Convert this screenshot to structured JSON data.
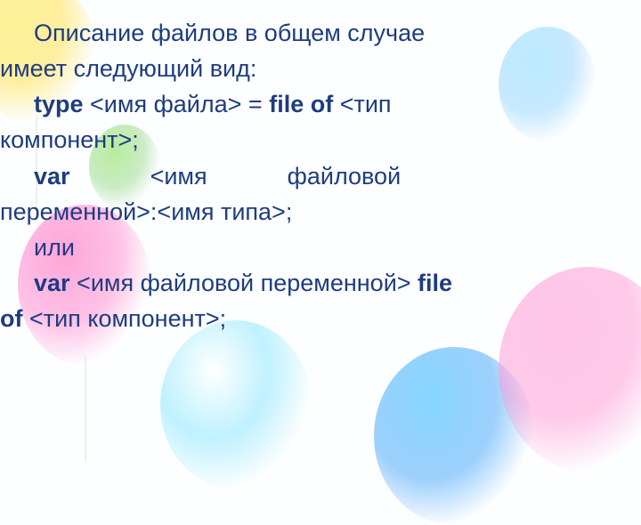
{
  "doc": {
    "intro_a": "Описание файлов в общем случае",
    "intro_b": "имеет следующий вид:",
    "kw_type": "type",
    "tok_fname_open": " <имя файла> ",
    "eq": "= ",
    "kw_fileof1": "file of",
    "tok_tipcomp_a": " <тип",
    "tok_tipcomp_b": "компонент>;",
    "kw_var1": "var",
    "var1_gap": "            ",
    "tok_fvar_open": "<имя            файловой",
    "tok_fvar_rest": "переменной>:<имя типа>;",
    "ili": "или",
    "kw_var2": "var",
    "tok_fvar2": " <имя файловой переменной>  ",
    "kw_file2": "file",
    "kw_of2": "of",
    "tok_tipcomp2": " <тип компонент>;"
  }
}
